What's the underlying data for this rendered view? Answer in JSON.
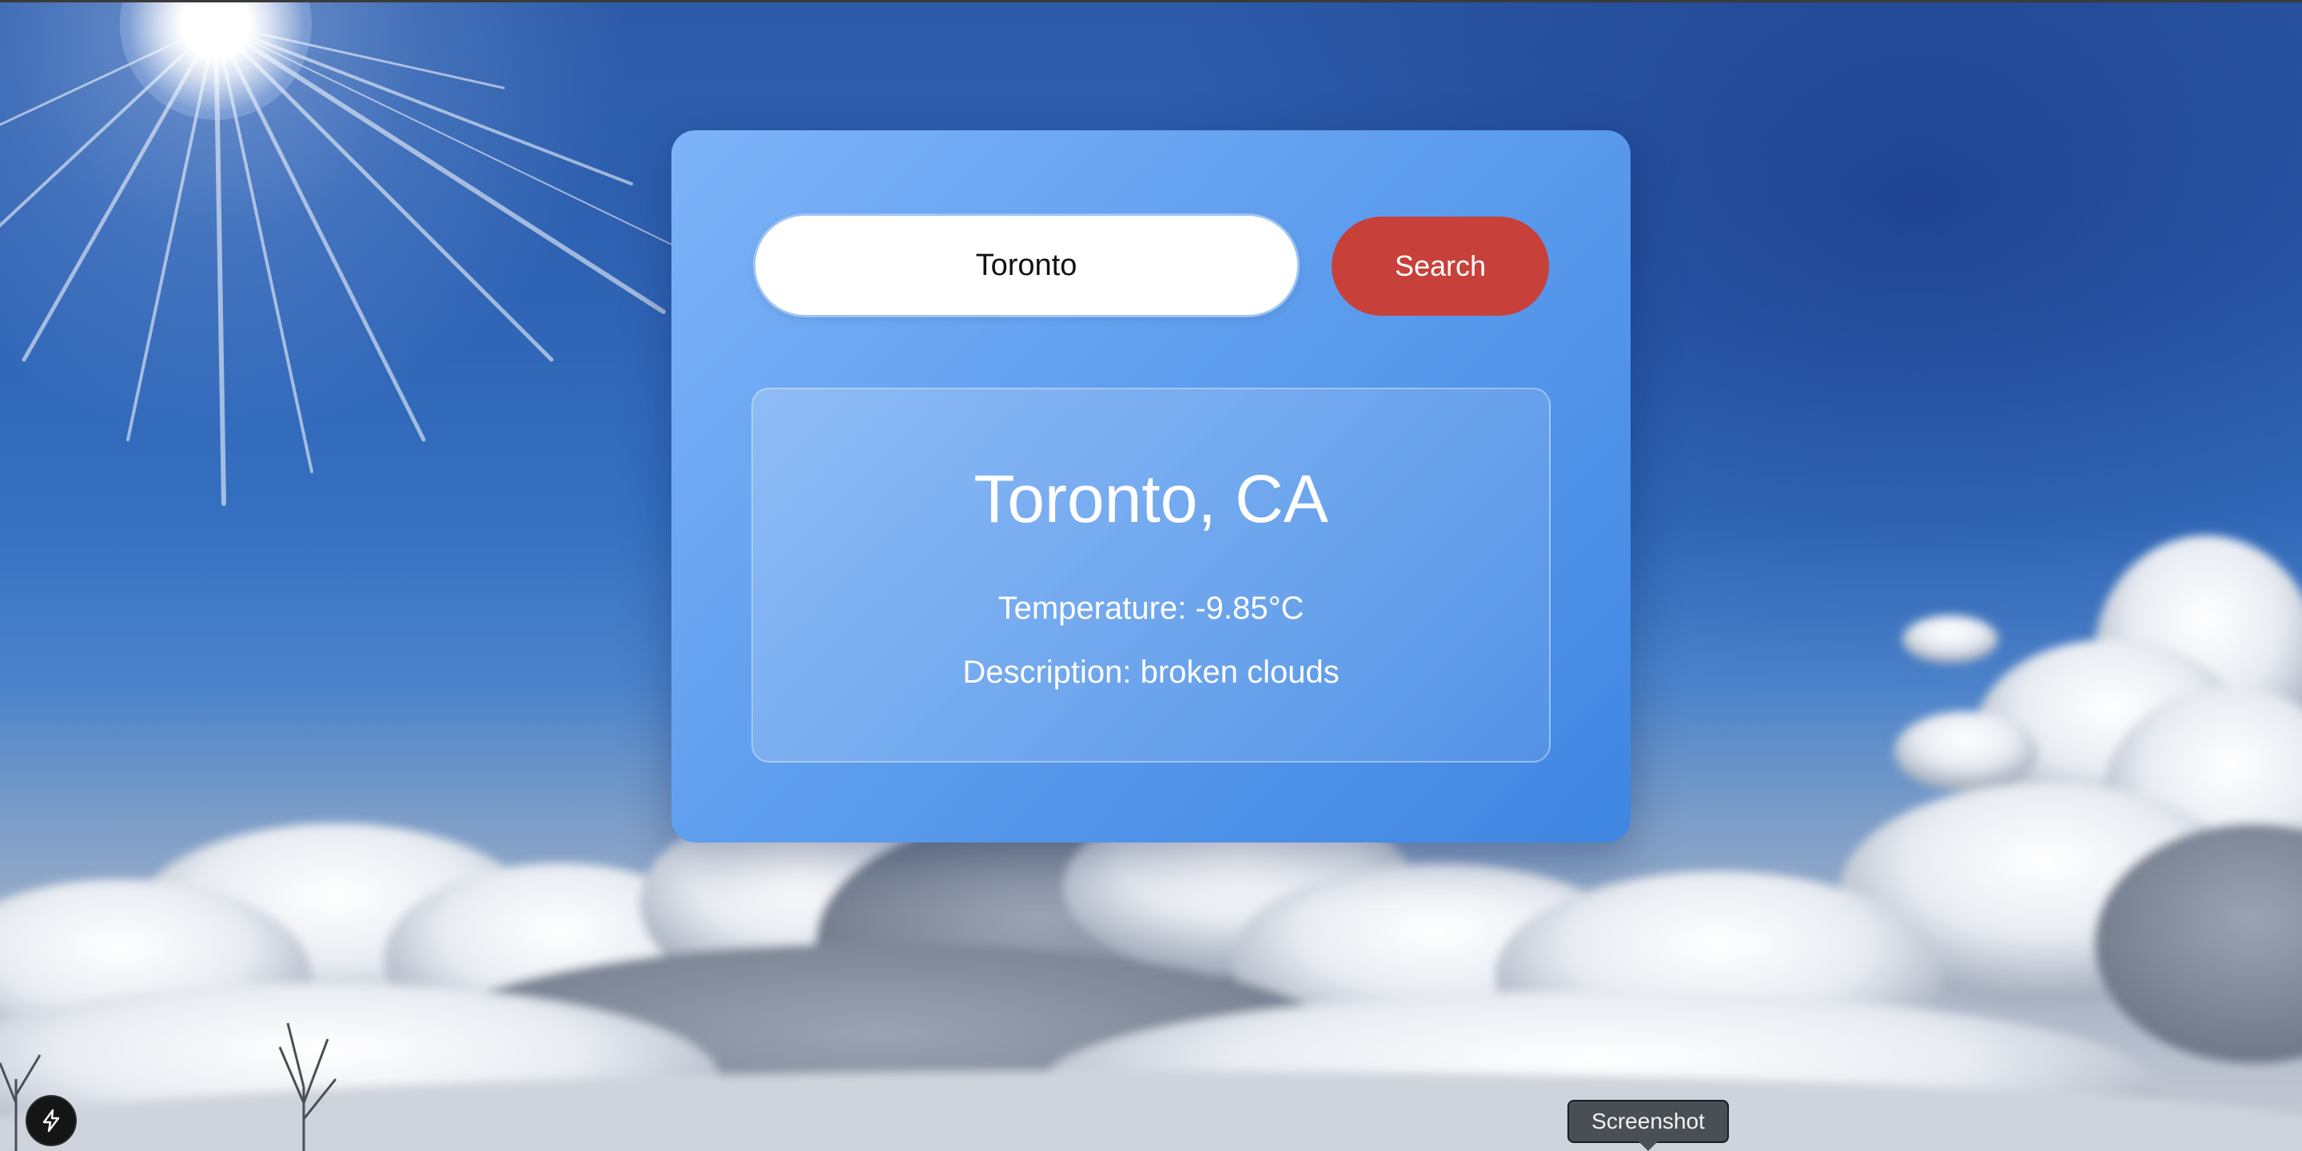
{
  "search": {
    "value": "Toronto",
    "button_label": "Search"
  },
  "weather": {
    "location": "Toronto, CA",
    "temperature": "Temperature: -9.85°C",
    "description": "Description: broken clouds"
  },
  "tooltip": {
    "label": "Screenshot"
  },
  "icons": {
    "dev_badge": "lightning-bolt-icon"
  },
  "colors": {
    "search_button": "#c8403a",
    "card_start": "#7db3f8",
    "card_end": "#3f86e2"
  }
}
